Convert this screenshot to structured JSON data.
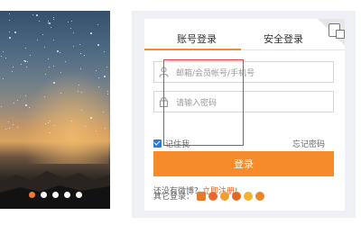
{
  "carousel": {
    "slide_count": 5,
    "active_index": 0
  },
  "tabs": [
    {
      "label": "账号登录",
      "active": true
    },
    {
      "label": "安全登录",
      "active": false
    }
  ],
  "form": {
    "account_placeholder": "邮箱/会员帐号/手机号",
    "password_placeholder": "请输入密码",
    "remember_label": "记住我",
    "remember_checked": true,
    "forgot_label": "忘记密码",
    "login_label": "登录"
  },
  "signup": {
    "prompt": "还没有微博？",
    "link": "立即注册!"
  },
  "other_login": {
    "label": "其它登录："
  },
  "colors": {
    "accent": "#f58b2b",
    "tab_underline": "#f08a2c",
    "link": "#e0611c",
    "annotation": "#e53935",
    "checkbox": "#2d7bd8"
  },
  "icons": [
    "user-icon",
    "lock-icon",
    "qr-switch-icon",
    "checkbox-checked-icon"
  ]
}
